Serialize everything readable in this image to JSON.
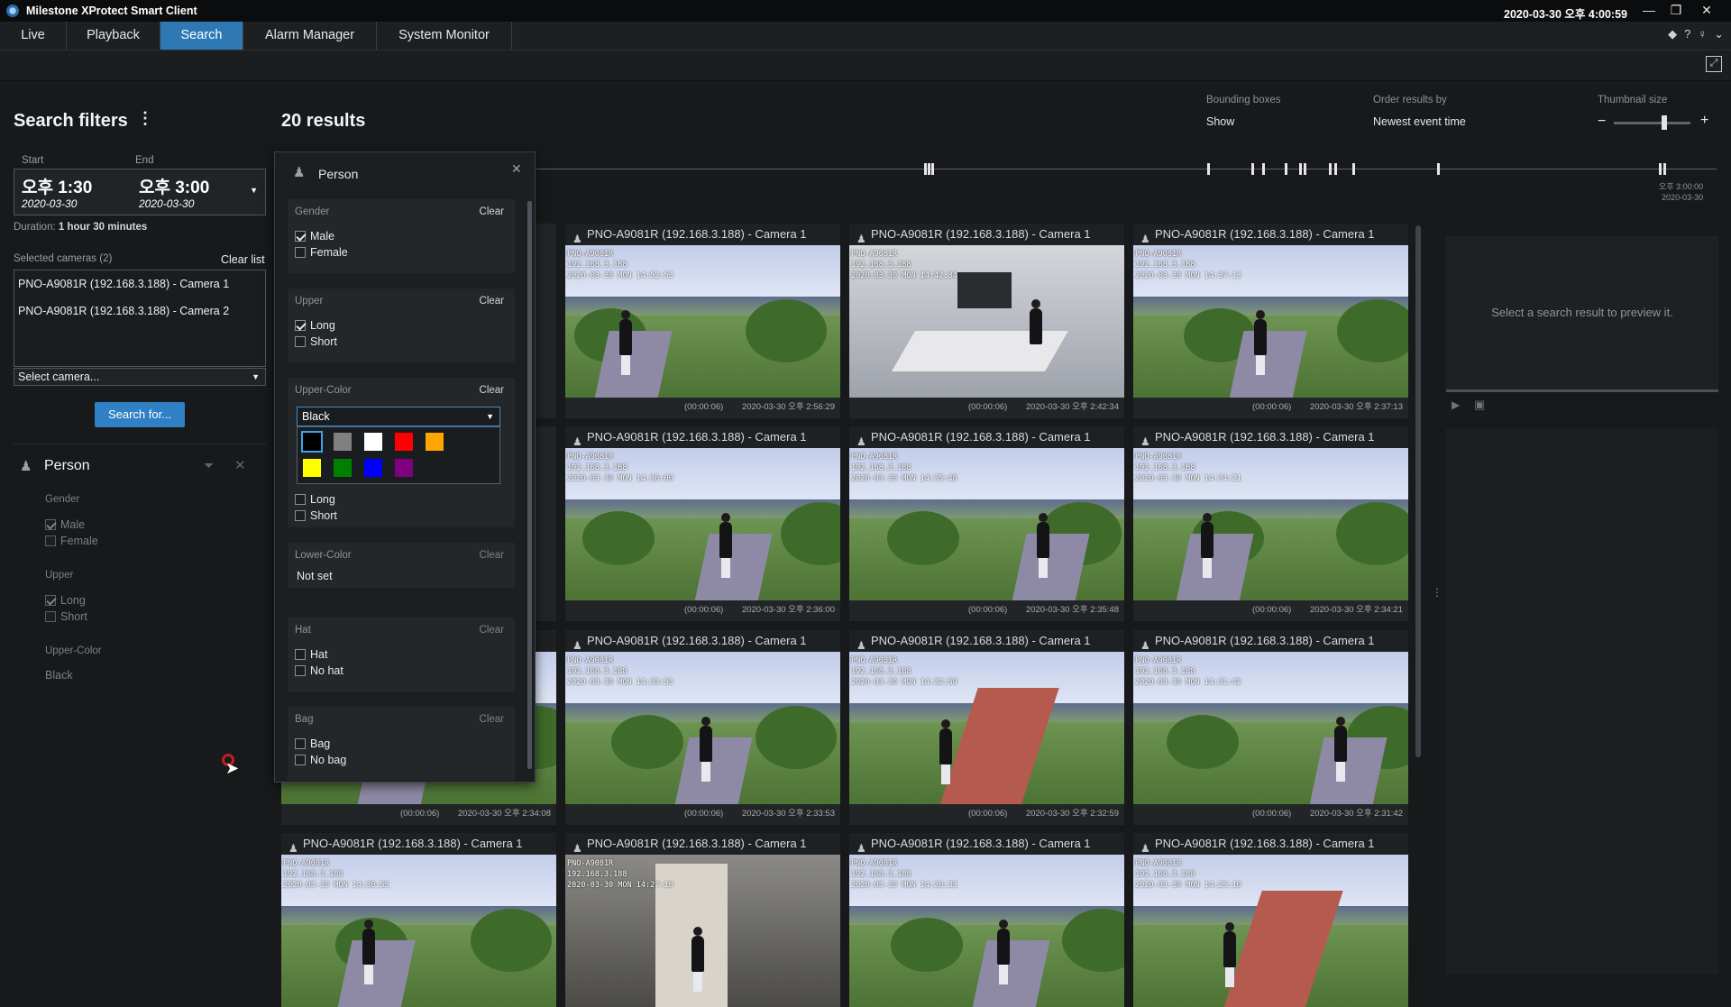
{
  "app": {
    "title": "Milestone XProtect Smart Client",
    "clock": "2020-03-30 오후 4:00:59"
  },
  "tabs": [
    {
      "label": "Live"
    },
    {
      "label": "Playback"
    },
    {
      "label": "Search"
    },
    {
      "label": "Alarm Manager"
    },
    {
      "label": "System Monitor"
    }
  ],
  "filters": {
    "title": "Search filters",
    "start_label": "Start",
    "end_label": "End",
    "start_time": "오후 1:30",
    "start_date": "2020-03-30",
    "end_time": "오후 3:00",
    "end_date": "2020-03-30",
    "duration_label": "Duration:",
    "duration_value": "1 hour 30 minutes",
    "selected_cameras_label": "Selected cameras (2)",
    "clear_list": "Clear list",
    "cameras": [
      "PNO-A9081R (192.168.3.188) - Camera 1",
      "PNO-A9081R (192.168.3.188) - Camera 2"
    ],
    "select_camera": "Select camera...",
    "search_button": "Search for...",
    "person_filter": {
      "title": "Person",
      "gender_label": "Gender",
      "male": "Male",
      "female": "Female",
      "upper_label": "Upper",
      "long": "Long",
      "short": "Short",
      "upper_color_label": "Upper-Color",
      "upper_color_value": "Black"
    }
  },
  "results": {
    "title": "20 results",
    "bounding_boxes_label": "Bounding boxes",
    "bounding_boxes_value": "Show",
    "order_label": "Order results by",
    "order_value": "Newest event time",
    "thumb_label": "Thumbnail size",
    "timeline_end_time": "오후 3:00:00",
    "timeline_end_date": "2020-03-30",
    "preview_hint": "Select a search result to preview it."
  },
  "popup": {
    "title": "Person",
    "gender": {
      "label": "Gender",
      "clear": "Clear",
      "male": "Male",
      "female": "Female"
    },
    "upper": {
      "label": "Upper",
      "clear": "Clear",
      "long": "Long",
      "short": "Short"
    },
    "upper_color": {
      "label": "Upper-Color",
      "clear": "Clear",
      "value": "Black"
    },
    "lower": {
      "long": "Long",
      "short": "Short"
    },
    "lower_color": {
      "label": "Lower-Color",
      "clear": "Clear",
      "value": "Not set"
    },
    "hat": {
      "label": "Hat",
      "clear": "Clear",
      "hat": "Hat",
      "no_hat": "No hat"
    },
    "bag": {
      "label": "Bag",
      "clear": "Clear",
      "bag": "Bag",
      "no_bag": "No bag"
    },
    "swatches": [
      "#000000",
      "#808080",
      "#ffffff",
      "#ff0000",
      "#ffa500",
      "#ffff00",
      "#008000",
      "#0000ff",
      "#800080"
    ]
  },
  "cards": [
    {
      "cam": "PNO-A9081R (192.168.3.188) - Camera 1",
      "osd1": "PNO-A9081R",
      "osd2": "192.168.3.188",
      "osd3": "2020-03-30 MON 14:52:53",
      "dur": "(00:00:06)",
      "time": "2020-03-30 오후 2:56:29"
    },
    {
      "cam": "PNO-A9081R (192.168.3.188) - Camera 1",
      "osd1": "PNO-A9081R",
      "osd2": "192.168.3.188",
      "osd3": "2020-03-30 MON 14:42:34",
      "dur": "(00:00:06)",
      "time": "2020-03-30 오후 2:42:34"
    },
    {
      "cam": "PNO-A9081R (192.168.3.188) - Camera 1",
      "osd1": "PNO-A9081R",
      "osd2": "192.168.3.188",
      "osd3": "2020-03-30 MON 14:37:13",
      "dur": "(00:00:06)",
      "time": "2020-03-30 오후 2:37:13"
    },
    {
      "cam": "PNO-A9081R (192.168.3.188) - Camera 1",
      "osd1": "PNO-A9081R",
      "osd2": "192.168.3.188",
      "osd3": "2020-03-30 MON 14:36:00",
      "dur": "(00:00:06)",
      "time": "2020-03-30 오후 2:36:00"
    },
    {
      "cam": "PNO-A9081R (192.168.3.188) - Camera 1",
      "osd1": "PNO-A9081R",
      "osd2": "192.168.3.188",
      "osd3": "2020-03-30 MON 14:35:48",
      "dur": "(00:00:06)",
      "time": "2020-03-30 오후 2:35:48"
    },
    {
      "cam": "PNO-A9081R (192.168.3.188) - Camera 1",
      "osd1": "PNO-A9081R",
      "osd2": "192.168.3.188",
      "osd3": "2020-03-30 MON 14:34:21",
      "dur": "(00:00:06)",
      "time": "2020-03-30 오후 2:34:21"
    },
    {
      "cam": "PNO-A9081R (192.168.3.188) - Camera 1",
      "osd1": "PNO-A9081R",
      "osd2": "192.168.3.188",
      "osd3": "2020-03-30 MON 14:34:08",
      "dur": "(00:00:06)",
      "time": "2020-03-30 오후 2:34:08"
    },
    {
      "cam": "PNO-A9081R (192.168.3.188) - Camera 1",
      "osd1": "PNO-A9081R",
      "osd2": "192.168.3.188",
      "osd3": "2020-03-30 MON 14:33:53",
      "dur": "(00:00:06)",
      "time": "2020-03-30 오후 2:33:53"
    },
    {
      "cam": "PNO-A9081R (192.168.3.188) - Camera 1",
      "osd1": "PNO-A9081R",
      "osd2": "192.168.3.188",
      "osd3": "2020-03-30 MON 14:32:59",
      "dur": "(00:00:06)",
      "time": "2020-03-30 오후 2:32:59"
    },
    {
      "cam": "PNO-A9081R (192.168.3.188) - Camera 1",
      "osd1": "PNO-A9081R",
      "osd2": "192.168.3.188",
      "osd3": "2020-03-30 MON 14:31:42",
      "dur": "(00:00:06)",
      "time": "2020-03-30 오후 2:31:42"
    },
    {
      "cam": "PNO-A9081R (192.168.3.188) - Camera 1",
      "osd1": "PNO-A9081R",
      "osd2": "192.168.3.188",
      "osd3": "2020-03-30 MON 14:30:55"
    },
    {
      "cam": "PNO-A9081R (192.168.3.188) - Camera 1",
      "osd1": "PNO-A9081R",
      "osd2": "192.168.3.188",
      "osd3": "2020-03-30 MON 14:27:18"
    },
    {
      "cam": "PNO-A9081R (192.168.3.188) - Camera 1",
      "osd1": "PNO-A9081R",
      "osd2": "192.168.3.188",
      "osd3": "2020-03-30 MON 14:26:33"
    },
    {
      "cam": "PNO-A9081R (192.168.3.188) - Camera 1",
      "osd1": "PNO-A9081R",
      "osd2": "192.168.3.188",
      "osd3": "2020-03-30 MON 14:25:10"
    }
  ]
}
